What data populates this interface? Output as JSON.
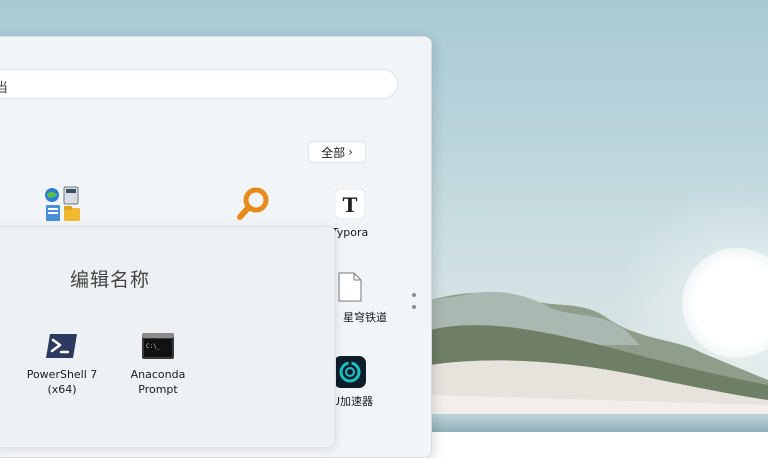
{
  "search": {
    "text": "当"
  },
  "pinned": {
    "all_apps_label": "全部",
    "apps": [
      {
        "name": "",
        "icon": "control-panel-icon"
      },
      {
        "name": "",
        "icon": "everything-search-icon"
      },
      {
        "name": "Typora",
        "icon": "typora-icon"
      },
      {
        "name": "星穹铁道",
        "prefix": "：",
        "icon": "file-icon"
      },
      {
        "name": "U加速器",
        "icon": "uu-accelerator-icon"
      }
    ]
  },
  "folder": {
    "title": "编辑名称",
    "apps": [
      {
        "line1": "PowerShell 7",
        "line2": "(x64)",
        "icon": "powershell-icon"
      },
      {
        "line1": "Anaconda",
        "line2": "Prompt",
        "icon": "anaconda-prompt-icon"
      }
    ]
  },
  "colors": {
    "accent_orange": "#e88a1a",
    "powershell_blue": "#2b3a5e",
    "uu_teal": "#16c2c2"
  }
}
